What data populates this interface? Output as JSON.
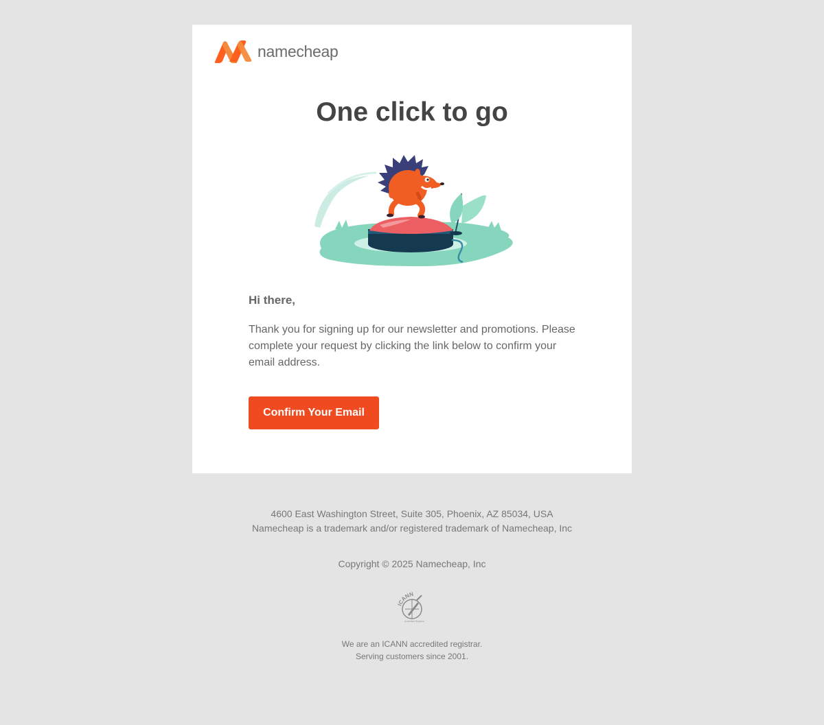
{
  "brand": {
    "name": "namecheap",
    "logo_colors": [
      "#ff5f1f",
      "#f48a3c"
    ]
  },
  "email": {
    "headline": "One click to go",
    "greeting": "Hi there,",
    "body": "Thank you for signing up for our newsletter and promotions. Please complete your request by clicking the link below to confirm your email address.",
    "cta_label": "Confirm Your Email",
    "cta_color": "#f04a21"
  },
  "footer": {
    "address": "4600 East Washington Street, Suite 305, Phoenix, AZ 85034, USA",
    "trademark": "Namecheap is a trademark and/or registered trademark of Namecheap, Inc",
    "copyright": "Copyright © 2025 Namecheap, Inc",
    "icann_logo_text": "ICANN",
    "icann_logo_subtext": "Accredited Registrar",
    "accredited": "We are an ICANN accredited registrar.",
    "since": "Serving customers since 2001."
  },
  "colors": {
    "page_bg": "#e5e4e5",
    "card_bg": "#ffffff",
    "text": "#666666",
    "heading": "#444444"
  },
  "icons": [
    "namecheap-logo-icon",
    "hedgehog-illustration",
    "icann-logo-icon"
  ]
}
